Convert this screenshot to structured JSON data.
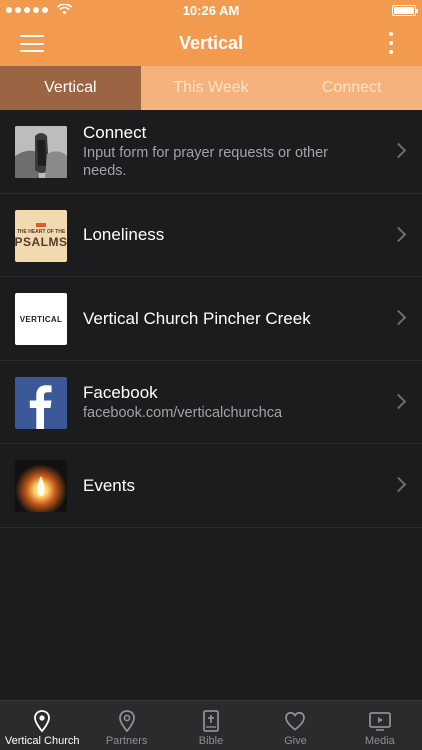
{
  "status_bar": {
    "time": "10:26 AM"
  },
  "header": {
    "title": "Vertical",
    "menu_icon": "hamburger-icon",
    "more_icon": "kebab-icon"
  },
  "tabs": [
    {
      "label": "Vertical",
      "active": true
    },
    {
      "label": "This Week",
      "active": false
    },
    {
      "label": "Connect",
      "active": false
    }
  ],
  "items": [
    {
      "title": "Connect",
      "subtitle": "Input form for prayer requests or other needs.",
      "icon": "praying-hands-thumbnail"
    },
    {
      "title": "Loneliness",
      "subtitle": "",
      "icon": "psalms-thumbnail",
      "thumb_text": {
        "line1": "THE HEART OF THE",
        "line2": "PSALMS"
      }
    },
    {
      "title": "Vertical Church Pincher Creek",
      "subtitle": "",
      "icon": "vertical-logo-thumbnail",
      "thumb_text": {
        "logo": "VERTICAL"
      }
    },
    {
      "title": "Facebook",
      "subtitle": "facebook.com/verticalchurchca",
      "icon": "facebook-icon"
    },
    {
      "title": "Events",
      "subtitle": "",
      "icon": "campfire-thumbnail"
    }
  ],
  "tabbar": [
    {
      "label": "Vertical Church",
      "icon": "location-pin-icon",
      "active": true
    },
    {
      "label": "Partners",
      "icon": "location-pin-icon",
      "active": false
    },
    {
      "label": "Bible",
      "icon": "bible-icon",
      "active": false
    },
    {
      "label": "Give",
      "icon": "heart-icon",
      "active": false
    },
    {
      "label": "Media",
      "icon": "media-player-icon",
      "active": false
    }
  ],
  "colors": {
    "accent": "#f29a4e",
    "tab_active": "#9b6442",
    "tab_bg": "#f5b27a",
    "background": "#1c1c1e",
    "facebook_blue": "#3b5998"
  }
}
